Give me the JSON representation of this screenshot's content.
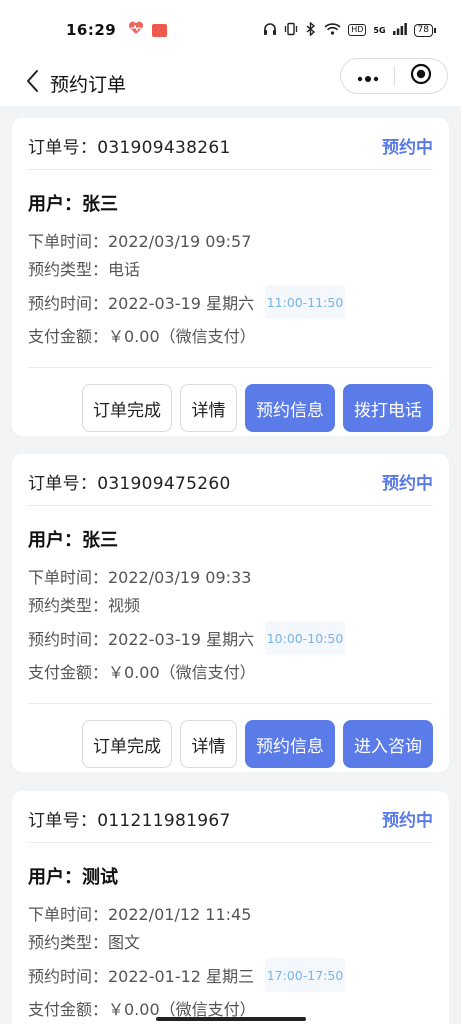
{
  "status_bar": {
    "time": "16:29",
    "hd_label": "HD",
    "signal_label": "5G",
    "battery": "78",
    "icons": [
      "heart-icon",
      "mini-app-icon",
      "headphones-icon",
      "vibrate-icon",
      "bluetooth-icon",
      "wifi-icon",
      "signal-icon",
      "battery-icon"
    ]
  },
  "nav": {
    "title": "预约订单",
    "back_icon": "chevron-left-icon",
    "more_icon": "more-dots-icon",
    "close_icon": "target-circle-icon"
  },
  "colors": {
    "primary": "#5a7be8",
    "status": "#5a7be8",
    "time_slot_text": "#7ab4e6",
    "time_slot_bg": "#f4f8fc",
    "page_bg": "#f2f3f5"
  },
  "orders": [
    {
      "order_no": "订单号：031909438261",
      "status": "预约中",
      "user": "用户：张三",
      "order_time": "下单时间：2022/03/19 09:57",
      "appointment_type": "预约类型：电话",
      "appointment_time": "预约时间：2022-03-19 星期六",
      "time_slot": "11:00-11:50",
      "payment": "支付金额：￥0.00（微信支付）",
      "actions": {
        "complete": "订单完成",
        "detail": "详情",
        "info": "预约信息",
        "primary_action": "拨打电话"
      }
    },
    {
      "order_no": "订单号：031909475260",
      "status": "预约中",
      "user": "用户：张三",
      "order_time": "下单时间：2022/03/19 09:33",
      "appointment_type": "预约类型：视频",
      "appointment_time": "预约时间：2022-03-19 星期六",
      "time_slot": "10:00-10:50",
      "payment": "支付金额：￥0.00（微信支付）",
      "actions": {
        "complete": "订单完成",
        "detail": "详情",
        "info": "预约信息",
        "primary_action": "进入咨询"
      }
    },
    {
      "order_no": "订单号：011211981967",
      "status": "预约中",
      "user": "用户：测试",
      "order_time": "下单时间：2022/01/12 11:45",
      "appointment_type": "预约类型：图文",
      "appointment_time": "预约时间：2022-01-12 星期三",
      "time_slot": "17:00-17:50",
      "payment": "支付金额：￥0.00（微信支付）"
    }
  ]
}
